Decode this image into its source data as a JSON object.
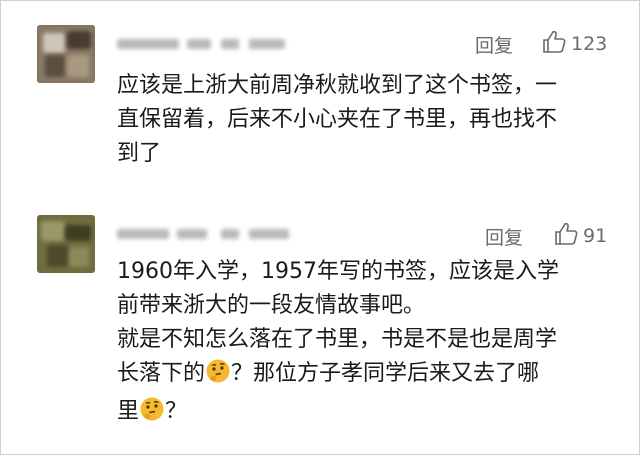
{
  "comments": [
    {
      "username": "•••••",
      "reply_label": "回复",
      "like_count": "123",
      "lines": [
        "应该是上浙大前周净秋就收到了这个书签，一",
        "直保留着，后来不小心夹在了书里，再也找不",
        "到了"
      ]
    },
    {
      "username": "•••••",
      "reply_label": "回复",
      "like_count": "91",
      "lines": [
        "1960年入学，1957年写的书签，应该是入学",
        "前带来浙大的一段友情故事吧。",
        "就是不知怎么落在了书里，书是不是也是周学",
        "长落下的",
        "？那位方子孝同学后来又去了哪",
        "里",
        "？"
      ]
    }
  ],
  "icons": {
    "like": "thumbs-up-icon",
    "emoji": "thinking-face-emoji"
  },
  "colors": {
    "text": "#1a1a1a",
    "meta": "#6b6b6b",
    "emoji": "#f5b82e"
  }
}
